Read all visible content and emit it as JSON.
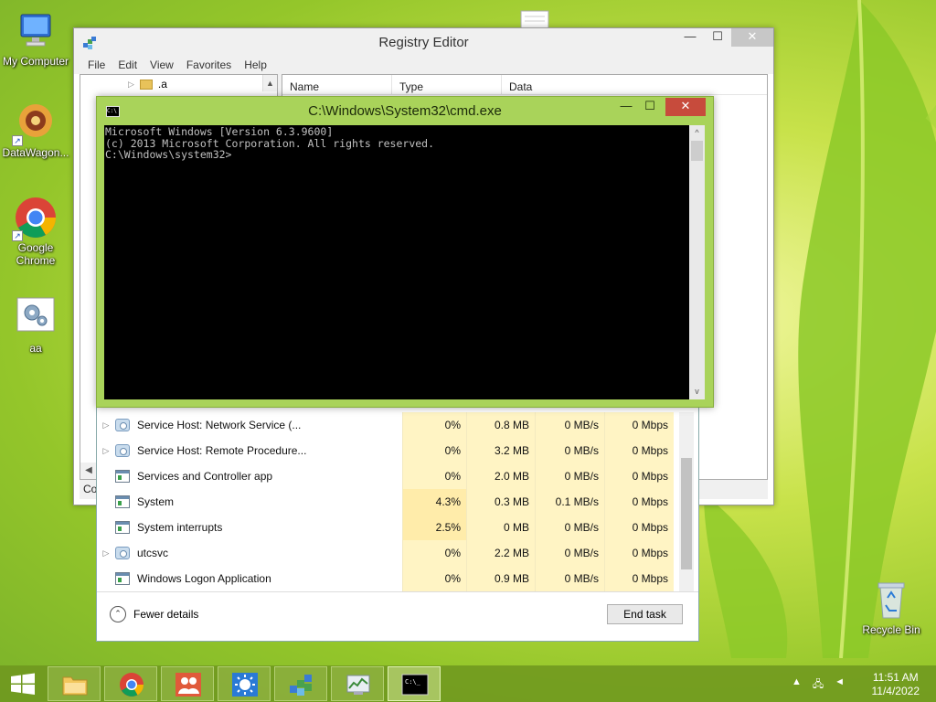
{
  "desktop": {
    "icons": [
      {
        "label": "My Computer"
      },
      {
        "label": "DataWagon..."
      },
      {
        "label": "Google Chrome"
      },
      {
        "label": "aa"
      },
      {
        "label": "Recycle Bin"
      }
    ]
  },
  "registry_editor": {
    "title": "Registry Editor",
    "menu": [
      "File",
      "Edit",
      "View",
      "Favorites",
      "Help"
    ],
    "tree_item": ".a",
    "columns": [
      "Name",
      "Type",
      "Data"
    ],
    "status": "Co"
  },
  "cmd": {
    "title": "C:\\Windows\\System32\\cmd.exe",
    "lines": [
      "Microsoft Windows [Version 6.3.9600]",
      "(c) 2013 Microsoft Corporation. All rights reserved.",
      "C:\\Windows\\system32>"
    ]
  },
  "task_manager": {
    "rows": [
      {
        "name": "Service Host: Network Service (...",
        "icon": "gear",
        "expandable": true,
        "cpu": "0%",
        "memory": "0.8 MB",
        "disk": "0 MB/s",
        "network": "0 Mbps"
      },
      {
        "name": "Service Host: Remote Procedure...",
        "icon": "gear",
        "expandable": true,
        "cpu": "0%",
        "memory": "3.2 MB",
        "disk": "0 MB/s",
        "network": "0 Mbps"
      },
      {
        "name": "Services and Controller app",
        "icon": "app",
        "expandable": false,
        "cpu": "0%",
        "memory": "2.0 MB",
        "disk": "0 MB/s",
        "network": "0 Mbps"
      },
      {
        "name": "System",
        "icon": "app",
        "expandable": false,
        "cpu": "4.3%",
        "memory": "0.3 MB",
        "disk": "0.1 MB/s",
        "network": "0 Mbps"
      },
      {
        "name": "System interrupts",
        "icon": "app",
        "expandable": false,
        "cpu": "2.5%",
        "memory": "0 MB",
        "disk": "0 MB/s",
        "network": "0 Mbps"
      },
      {
        "name": "utcsvc",
        "icon": "gear",
        "expandable": true,
        "cpu": "0%",
        "memory": "2.2 MB",
        "disk": "0 MB/s",
        "network": "0 Mbps"
      },
      {
        "name": "Windows Logon Application",
        "icon": "app",
        "expandable": false,
        "cpu": "0%",
        "memory": "0.9 MB",
        "disk": "0 MB/s",
        "network": "0 Mbps"
      }
    ],
    "fewer_details": "Fewer details",
    "end_task": "End task"
  },
  "taskbar": {
    "apps": [
      "file-explorer",
      "google-chrome",
      "people",
      "sun-app",
      "registry-editor",
      "task-manager",
      "command-prompt"
    ],
    "active_app": "command-prompt",
    "time": "11:51 AM",
    "date": "11/4/2022"
  },
  "colors": {
    "cmd_frame": "#a9d35a",
    "close_button": "#c74b3c",
    "taskbar": "#6e961e"
  }
}
